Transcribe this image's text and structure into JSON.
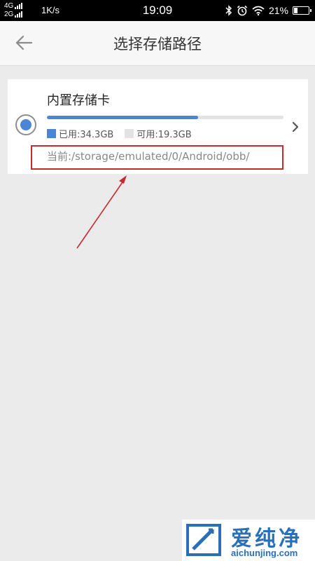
{
  "status_bar": {
    "net_line1": "4G",
    "net_line2": "2G",
    "speed": "1K/s",
    "time": "19:09",
    "battery_pct": "21%"
  },
  "header": {
    "title": "选择存储路径"
  },
  "storage": {
    "name": "内置存储卡",
    "used_label": "已用:34.3GB",
    "free_label": "可用:19.3GB",
    "used_fraction": 0.64,
    "current_path": "当前:/storage/emulated/0/Android/obb/",
    "selected": true
  },
  "colors": {
    "accent": "#4a86d8",
    "used": "#4a86d8",
    "free": "#e3e3e3",
    "annotation": "#c62a2f"
  },
  "watermark": {
    "text_cn": "爱纯净",
    "url": "aichunjing.com"
  }
}
